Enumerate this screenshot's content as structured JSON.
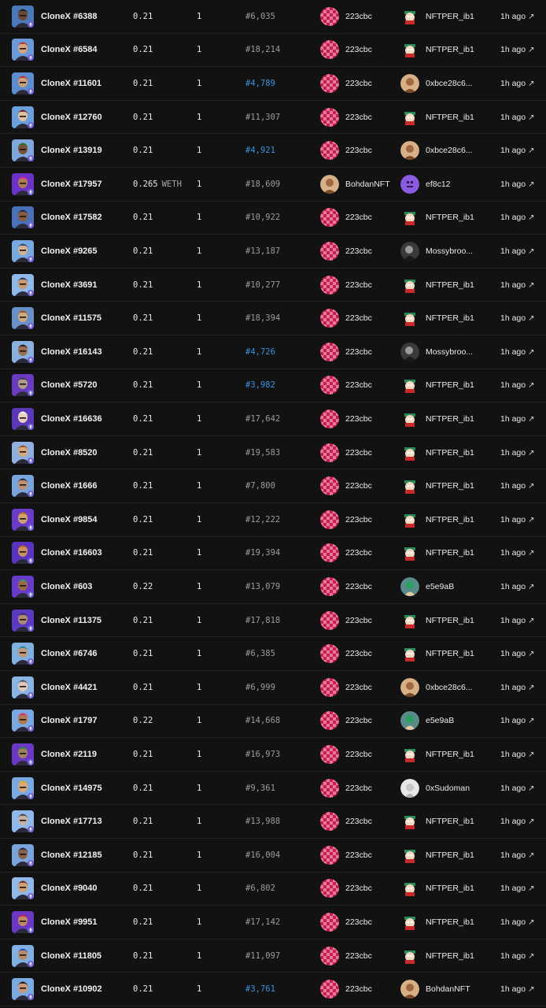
{
  "sales": [
    {
      "item": "CloneX #6388",
      "price": "0.21",
      "currency": "",
      "quantity": "1",
      "rank": "#6,035",
      "rare": false,
      "from": "223cbc",
      "from_avatar": "checker",
      "to": "NFTPER_ib1",
      "to_avatar": "cartoon",
      "time": "1h ago",
      "skin": "#6b4a35",
      "hair": "#1c1c1c",
      "bg": "#4a78b8"
    },
    {
      "item": "CloneX #6584",
      "price": "0.21",
      "currency": "",
      "quantity": "1",
      "rank": "#18,214",
      "rare": false,
      "from": "223cbc",
      "from_avatar": "checker",
      "to": "NFTPER_ib1",
      "to_avatar": "cartoon",
      "time": "1h ago",
      "skin": "#d9a57c",
      "hair": "#b83232",
      "bg": "#6a98d8"
    },
    {
      "item": "CloneX #11601",
      "price": "0.21",
      "currency": "",
      "quantity": "1",
      "rank": "#4,789",
      "rare": true,
      "from": "223cbc",
      "from_avatar": "checker",
      "to": "0xbce28c6...",
      "to_avatar": "person",
      "time": "1h ago",
      "skin": "#caa07a",
      "hair": "#c02828",
      "bg": "#5d8fd0"
    },
    {
      "item": "CloneX #12760",
      "price": "0.21",
      "currency": "",
      "quantity": "1",
      "rank": "#11,307",
      "rare": false,
      "from": "223cbc",
      "from_avatar": "checker",
      "to": "NFTPER_ib1",
      "to_avatar": "cartoon",
      "time": "1h ago",
      "skin": "#e0c0a0",
      "hair": "#6a1e28",
      "bg": "#6aa0dc"
    },
    {
      "item": "CloneX #13919",
      "price": "0.21",
      "currency": "",
      "quantity": "1",
      "rank": "#4,921",
      "rare": true,
      "from": "223cbc",
      "from_avatar": "checker",
      "to": "0xbce28c6...",
      "to_avatar": "person",
      "time": "1h ago",
      "skin": "#7a5238",
      "hair": "#1f6f2a",
      "bg": "#7ea8dc"
    },
    {
      "item": "CloneX #17957",
      "price": "0.265",
      "currency": "WETH",
      "quantity": "1",
      "rank": "#18,609",
      "rare": false,
      "from": "BohdanNFT",
      "from_avatar": "person",
      "to": "ef8c12",
      "to_avatar": "pixel",
      "time": "1h ago",
      "skin": "#b07a55",
      "hair": "#e02a8c",
      "bg": "#6a32c8"
    },
    {
      "item": "CloneX #17582",
      "price": "0.21",
      "currency": "",
      "quantity": "1",
      "rank": "#10,922",
      "rare": false,
      "from": "223cbc",
      "from_avatar": "checker",
      "to": "NFTPER_ib1",
      "to_avatar": "cartoon",
      "time": "1h ago",
      "skin": "#8a5a3c",
      "hair": "#1e2a4a",
      "bg": "#4a70b8"
    },
    {
      "item": "CloneX #9265",
      "price": "0.21",
      "currency": "",
      "quantity": "1",
      "rank": "#13,187",
      "rare": false,
      "from": "223cbc",
      "from_avatar": "checker",
      "to": "Mossybroo...",
      "to_avatar": "dark",
      "time": "1h ago",
      "skin": "#d8b090",
      "hair": "#2a4a6a",
      "bg": "#78a8e0"
    },
    {
      "item": "CloneX #3691",
      "price": "0.21",
      "currency": "",
      "quantity": "1",
      "rank": "#10,277",
      "rare": false,
      "from": "223cbc",
      "from_avatar": "checker",
      "to": "NFTPER_ib1",
      "to_avatar": "cartoon",
      "time": "1h ago",
      "skin": "#c89870",
      "hair": "#2a3a6a",
      "bg": "#90b8e8"
    },
    {
      "item": "CloneX #11575",
      "price": "0.21",
      "currency": "",
      "quantity": "1",
      "rank": "#18,394",
      "rare": false,
      "from": "223cbc",
      "from_avatar": "checker",
      "to": "NFTPER_ib1",
      "to_avatar": "cartoon",
      "time": "1h ago",
      "skin": "#d0a880",
      "hair": "#a0521e",
      "bg": "#6a90c8"
    },
    {
      "item": "CloneX #16143",
      "price": "0.21",
      "currency": "",
      "quantity": "1",
      "rank": "#4,726",
      "rare": true,
      "from": "223cbc",
      "from_avatar": "checker",
      "to": "Mossybroo...",
      "to_avatar": "dark",
      "time": "1h ago",
      "skin": "#9a7050",
      "hair": "#202020",
      "bg": "#8ab0e0"
    },
    {
      "item": "CloneX #5720",
      "price": "0.21",
      "currency": "",
      "quantity": "1",
      "rank": "#3,982",
      "rare": true,
      "from": "223cbc",
      "from_avatar": "checker",
      "to": "NFTPER_ib1",
      "to_avatar": "cartoon",
      "time": "1h ago",
      "skin": "#b09a8a",
      "hair": "#3a3a5a",
      "bg": "#6a3ac0"
    },
    {
      "item": "CloneX #16636",
      "price": "0.21",
      "currency": "",
      "quantity": "1",
      "rank": "#17,642",
      "rare": false,
      "from": "223cbc",
      "from_avatar": "checker",
      "to": "NFTPER_ib1",
      "to_avatar": "cartoon",
      "time": "1h ago",
      "skin": "#e8d0c0",
      "hair": "#f0f0f0",
      "bg": "#5a38b8"
    },
    {
      "item": "CloneX #8520",
      "price": "0.21",
      "currency": "",
      "quantity": "1",
      "rank": "#19,583",
      "rare": false,
      "from": "223cbc",
      "from_avatar": "checker",
      "to": "NFTPER_ib1",
      "to_avatar": "cartoon",
      "time": "1h ago",
      "skin": "#d8a878",
      "hair": "#a04a1a",
      "bg": "#90b0e0"
    },
    {
      "item": "CloneX #1666",
      "price": "0.21",
      "currency": "",
      "quantity": "1",
      "rank": "#7,800",
      "rare": false,
      "from": "223cbc",
      "from_avatar": "checker",
      "to": "NFTPER_ib1",
      "to_avatar": "cartoon",
      "time": "1h ago",
      "skin": "#c09070",
      "hair": "#202a3a",
      "bg": "#7aa4dc"
    },
    {
      "item": "CloneX #9854",
      "price": "0.21",
      "currency": "",
      "quantity": "1",
      "rank": "#12,222",
      "rare": false,
      "from": "223cbc",
      "from_avatar": "checker",
      "to": "NFTPER_ib1",
      "to_avatar": "cartoon",
      "time": "1h ago",
      "skin": "#d0a070",
      "hair": "#c07a1a",
      "bg": "#6a3ac8"
    },
    {
      "item": "CloneX #16603",
      "price": "0.21",
      "currency": "",
      "quantity": "1",
      "rank": "#19,394",
      "rare": false,
      "from": "223cbc",
      "from_avatar": "checker",
      "to": "NFTPER_ib1",
      "to_avatar": "cartoon",
      "time": "1h ago",
      "skin": "#c89060",
      "hair": "#c06a20",
      "bg": "#5a34c0"
    },
    {
      "item": "CloneX #603",
      "price": "0.22",
      "currency": "",
      "quantity": "1",
      "rank": "#13,079",
      "rare": false,
      "from": "223cbc",
      "from_avatar": "checker",
      "to": "e5e9aB",
      "to_avatar": "green",
      "time": "1h ago",
      "skin": "#9a6a48",
      "hair": "#2aa070",
      "bg": "#6a3ac8"
    },
    {
      "item": "CloneX #11375",
      "price": "0.21",
      "currency": "",
      "quantity": "1",
      "rank": "#17,818",
      "rare": false,
      "from": "223cbc",
      "from_avatar": "checker",
      "to": "NFTPER_ib1",
      "to_avatar": "cartoon",
      "time": "1h ago",
      "skin": "#b08a70",
      "hair": "#3a2a60",
      "bg": "#5a3ac0"
    },
    {
      "item": "CloneX #6746",
      "price": "0.21",
      "currency": "",
      "quantity": "1",
      "rank": "#6,385",
      "rare": false,
      "from": "223cbc",
      "from_avatar": "checker",
      "to": "NFTPER_ib1",
      "to_avatar": "cartoon",
      "time": "1h ago",
      "skin": "#c09878",
      "hair": "#1a8aa0",
      "bg": "#80b0e0"
    },
    {
      "item": "CloneX #4421",
      "price": "0.21",
      "currency": "",
      "quantity": "1",
      "rank": "#6,999",
      "rare": false,
      "from": "223cbc",
      "from_avatar": "checker",
      "to": "0xbce28c6...",
      "to_avatar": "person",
      "time": "1h ago",
      "skin": "#e0c8b8",
      "hair": "#505a6a",
      "bg": "#8ab4e4"
    },
    {
      "item": "CloneX #1797",
      "price": "0.22",
      "currency": "",
      "quantity": "1",
      "rank": "#14,668",
      "rare": false,
      "from": "223cbc",
      "from_avatar": "checker",
      "to": "e5e9aB",
      "to_avatar": "green",
      "time": "1h ago",
      "skin": "#b07850",
      "hair": "#e02a6a",
      "bg": "#7aa8e0"
    },
    {
      "item": "CloneX #2119",
      "price": "0.21",
      "currency": "",
      "quantity": "1",
      "rank": "#16,973",
      "rare": false,
      "from": "223cbc",
      "from_avatar": "checker",
      "to": "NFTPER_ib1",
      "to_avatar": "cartoon",
      "time": "1h ago",
      "skin": "#a08060",
      "hair": "#2a8a3a",
      "bg": "#6a38c4"
    },
    {
      "item": "CloneX #14975",
      "price": "0.21",
      "currency": "",
      "quantity": "1",
      "rank": "#9,361",
      "rare": false,
      "from": "223cbc",
      "from_avatar": "checker",
      "to": "0xSudoman",
      "to_avatar": "white",
      "time": "1h ago",
      "skin": "#d8a878",
      "hair": "#e0b020",
      "bg": "#7aa8e0"
    },
    {
      "item": "CloneX #17713",
      "price": "0.21",
      "currency": "",
      "quantity": "1",
      "rank": "#13,988",
      "rare": false,
      "from": "223cbc",
      "from_avatar": "checker",
      "to": "NFTPER_ib1",
      "to_avatar": "cartoon",
      "time": "1h ago",
      "skin": "#c8b0a0",
      "hair": "#404a5a",
      "bg": "#90b8e8"
    },
    {
      "item": "CloneX #12185",
      "price": "0.21",
      "currency": "",
      "quantity": "1",
      "rank": "#16,004",
      "rare": false,
      "from": "223cbc",
      "from_avatar": "checker",
      "to": "NFTPER_ib1",
      "to_avatar": "cartoon",
      "time": "1h ago",
      "skin": "#8a6048",
      "hair": "#202a40",
      "bg": "#7aa4dc"
    },
    {
      "item": "CloneX #9040",
      "price": "0.21",
      "currency": "",
      "quantity": "1",
      "rank": "#6,802",
      "rare": false,
      "from": "223cbc",
      "from_avatar": "checker",
      "to": "NFTPER_ib1",
      "to_avatar": "cartoon",
      "time": "1h ago",
      "skin": "#d0a078",
      "hair": "#6a2a1a",
      "bg": "#90b8e8"
    },
    {
      "item": "CloneX #9951",
      "price": "0.21",
      "currency": "",
      "quantity": "1",
      "rank": "#17,142",
      "rare": false,
      "from": "223cbc",
      "from_avatar": "checker",
      "to": "NFTPER_ib1",
      "to_avatar": "cartoon",
      "time": "1h ago",
      "skin": "#c08860",
      "hair": "#c82a4a",
      "bg": "#6a38c4"
    },
    {
      "item": "CloneX #11805",
      "price": "0.21",
      "currency": "",
      "quantity": "1",
      "rank": "#11,097",
      "rare": false,
      "from": "223cbc",
      "from_avatar": "checker",
      "to": "NFTPER_ib1",
      "to_avatar": "cartoon",
      "time": "1h ago",
      "skin": "#b88a68",
      "hair": "#2050c0",
      "bg": "#80b0e4"
    },
    {
      "item": "CloneX #10902",
      "price": "0.21",
      "currency": "",
      "quantity": "1",
      "rank": "#3,761",
      "rare": true,
      "from": "223cbc",
      "from_avatar": "checker",
      "to": "BohdanNFT",
      "to_avatar": "person",
      "time": "1h ago",
      "skin": "#c89878",
      "hair": "#1a1a1a",
      "bg": "#7aaae0"
    }
  ],
  "colors": {
    "background": "#121212",
    "row_divider": "#222224",
    "rank_rare": "#3a93e0",
    "rank_normal": "#9c9c9c",
    "text": "#ececec",
    "checker_red": "#c81e4a",
    "checker_pink": "#e27aa0",
    "eth_badge": "#6f63d8"
  },
  "icons": {
    "external_link": "arrow-up-right-icon",
    "chain_badge": "ethereum-icon"
  }
}
